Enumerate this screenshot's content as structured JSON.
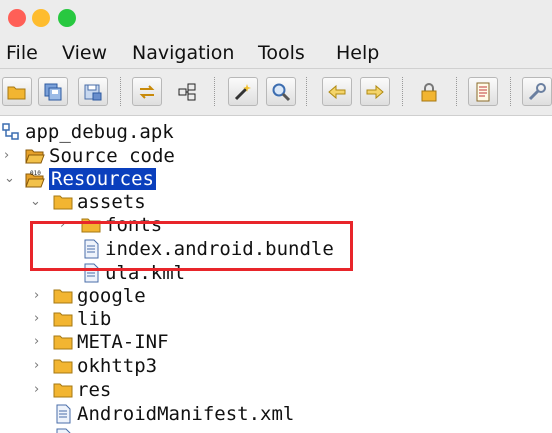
{
  "menu": {
    "file": "File",
    "view": "View",
    "navigation": "Navigation",
    "tools": "Tools",
    "help": "Help"
  },
  "tree": {
    "root": "app_debug.apk",
    "source_code": "Source code",
    "resources": "Resources",
    "assets": "assets",
    "fonts": "fonts",
    "index_bundle": "index.android.bundle",
    "ula": "ula.kml",
    "google": "google",
    "lib": "lib",
    "meta_inf": "META-INF",
    "okhttp3": "okhttp3",
    "res": "res",
    "manifest": "AndroidManifest.xml"
  },
  "colors": {
    "selection": "#0a3fbd",
    "highlight": "#e8252a",
    "folder": "#f2b531"
  }
}
